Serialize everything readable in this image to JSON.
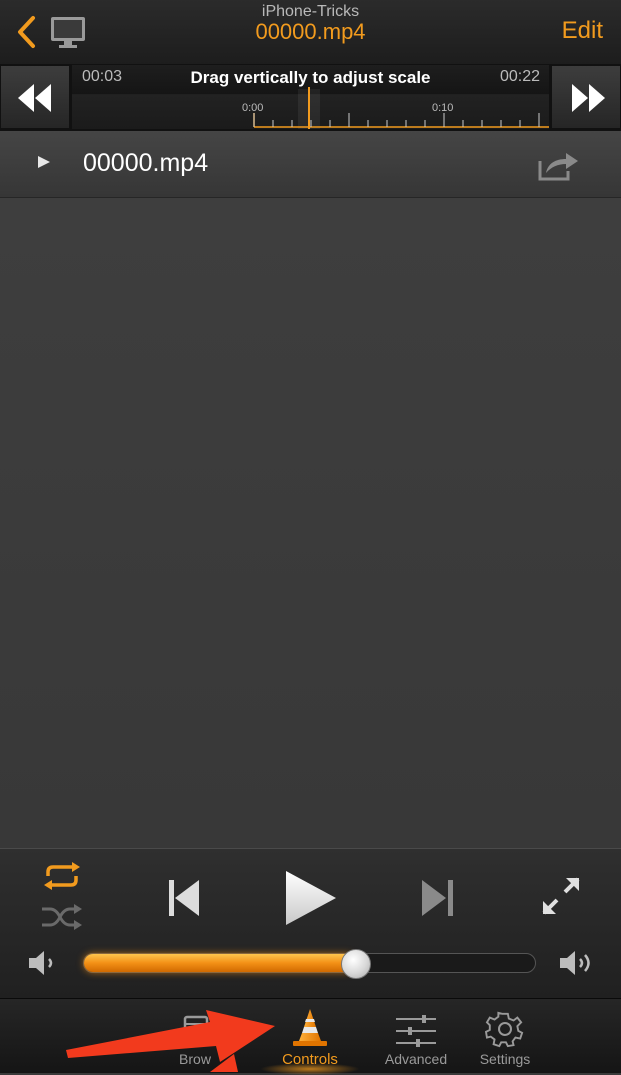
{
  "nav": {
    "subtitle": "iPhone-Tricks",
    "title": "00000.mp4",
    "edit_label": "Edit",
    "back_icon": "chevron-left-icon",
    "monitor_icon": "monitor-icon"
  },
  "scrubber": {
    "elapsed": "00:03",
    "remaining": "00:22",
    "hint": "Drag vertically to adjust scale",
    "tick_labels": [
      "0:00",
      "0:10"
    ]
  },
  "playlist": {
    "item_name": "00000.mp4"
  },
  "controls": {
    "volume_fraction": 0.6,
    "repeat_active": true,
    "shuffle_active": false
  },
  "tabs": {
    "browse_label": "Brow",
    "controls_label": "Controls",
    "advanced_label": "Advanced",
    "settings_label": "Settings",
    "active": "Controls"
  },
  "colors": {
    "accent": "#f29b1e",
    "annotation_arrow": "#f23a1d"
  }
}
